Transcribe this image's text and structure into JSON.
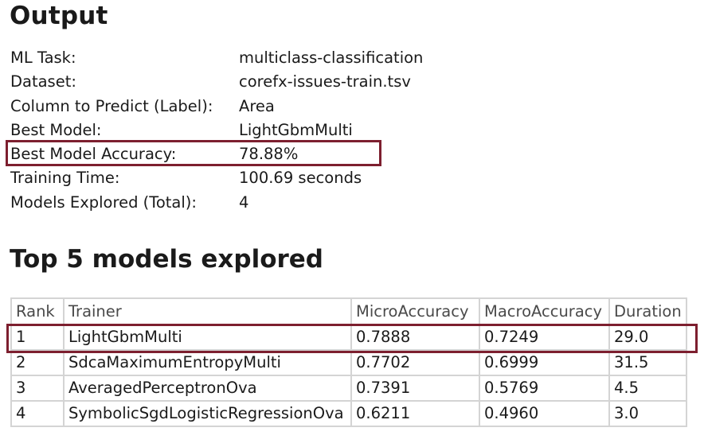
{
  "output": {
    "title": "Output",
    "rows": [
      {
        "key": "ML Task:",
        "value": "multiclass-classification"
      },
      {
        "key": "Dataset:",
        "value": "corefx-issues-train.tsv"
      },
      {
        "key": "Column to Predict (Label):",
        "value": "Area"
      },
      {
        "key": "Best Model:",
        "value": "LightGbmMulti"
      },
      {
        "key": "Best Model Accuracy:",
        "value": "78.88%"
      },
      {
        "key": "Training Time:",
        "value": "100.69 seconds"
      },
      {
        "key": "Models Explored (Total):",
        "value": "4"
      }
    ]
  },
  "models": {
    "title": "Top 5 models explored",
    "headers": [
      "Rank",
      "Trainer",
      "MicroAccuracy",
      "MacroAccuracy",
      "Duration"
    ],
    "rows": [
      [
        "1",
        "LightGbmMulti",
        "0.7888",
        "0.7249",
        "29.0"
      ],
      [
        "2",
        "SdcaMaximumEntropyMulti",
        "0.7702",
        "0.6999",
        "31.5"
      ],
      [
        "3",
        "AveragedPerceptronOva",
        "0.7391",
        "0.5769",
        "4.5"
      ],
      [
        "4",
        "SymbolicSgdLogisticRegressionOva",
        "0.6211",
        "0.4960",
        "3.0"
      ]
    ]
  },
  "colors": {
    "highlight": "#7d1f2f",
    "grid": "#d4d4d4"
  }
}
